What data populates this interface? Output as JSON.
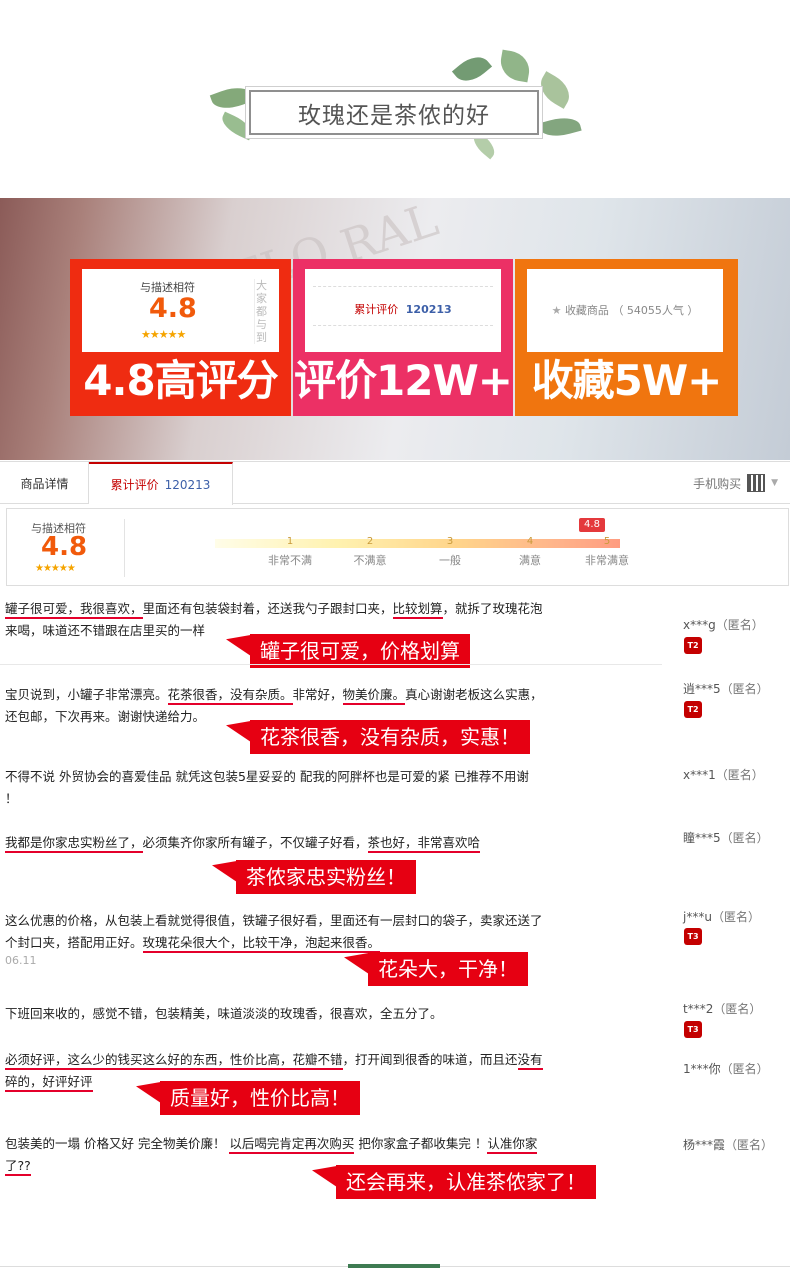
{
  "banner": {
    "title": "玫瑰还是茶侬的好"
  },
  "cards": [
    {
      "label": "与描述相符",
      "score": "4.8",
      "stars": "★★★★★",
      "side_text": "大家都与到",
      "big": "4.8高评分"
    },
    {
      "label": "累计评价",
      "count": "120213",
      "big": "评价12W+"
    },
    {
      "label": "收藏商品",
      "popularity": "（ 54055人气 ）",
      "big": "收藏5W+"
    }
  ],
  "tabs": {
    "details": "商品详情",
    "reviews": "累计评价",
    "reviews_count": "120213",
    "mobile": "手机购买"
  },
  "rating": {
    "label": "与描述相符",
    "score": "4.8",
    "stars": "★★★★★",
    "flag": "4.8",
    "ticks": [
      "1",
      "2",
      "3",
      "4",
      "5"
    ],
    "tick_labels": [
      "非常不满",
      "不满意",
      "一般",
      "满意",
      "非常满意"
    ]
  },
  "reviews": [
    {
      "text_parts": [
        "罐子很可爱，我很喜欢，",
        "里面还有包装袋封着，还送我勺子跟封口夹，",
        "比较划算",
        "，就拆了玫瑰花泡来喝，味道还不错跟在店里买的一样"
      ],
      "callout": "罐子很可爱，价格划算",
      "user": "x***g",
      "anon": "（匿名）",
      "level": "T2"
    },
    {
      "text_parts": [
        "宝贝说到，小罐子非常漂亮。",
        "花茶很香，没有杂质。",
        "非常好，",
        "物美价廉。",
        "真心谢谢老板这么实惠，还包邮，下次再来。谢谢快递给力。"
      ],
      "callout": "花茶很香，没有杂质，实惠！",
      "user": "逍***5",
      "anon": "（匿名）",
      "level": "T2"
    },
    {
      "text_parts": [
        "不得不说 外贸协会的喜爱佳品 就凭这包装5星妥妥的 配我的阿胖杯也是可爱的紧 已推荐不用谢 ！"
      ],
      "callout": "",
      "user": "x***1",
      "anon": "（匿名）",
      "level": ""
    },
    {
      "text_parts": [
        "我都是你家忠实粉丝了，",
        "必须集齐你家所有罐子，不仅罐子好看，",
        "茶也好，非常喜欢哈"
      ],
      "callout": "茶侬家忠实粉丝！",
      "user": "瞳***5",
      "anon": "（匿名）",
      "level": ""
    },
    {
      "text_parts": [
        "这么优惠的价格，从包装上看就觉得很值，铁罐子很好看，里面还有一层封口的袋子，卖家还送了个封口夹，搭配用正好。",
        "玫瑰花朵很大个，比较干净，泡起来很香。"
      ],
      "callout": "花朵大，干净！",
      "user": "j***u",
      "anon": "（匿名）",
      "level": "T3",
      "date": "06.11"
    },
    {
      "text_parts": [
        "下班回来收的，感觉不错，包装精美，味道淡淡的玫瑰香，很喜欢，全五分了。"
      ],
      "callout": "",
      "user": "t***2",
      "anon": "（匿名）",
      "level": "T3"
    },
    {
      "text_parts": [
        "必须好评，这么少的钱买这么好的东西，性价比高，花瓣不错",
        "，打开闻到很香的味道，而且还",
        "没有碎的，好评好评"
      ],
      "callout": "质量好，性价比高！",
      "user": "1***你",
      "anon": "（匿名）",
      "level": ""
    },
    {
      "text_parts": [
        "包装美的一塌 价格又好 完全物美价廉！ ",
        "以后喝完肯定再次购买",
        " 把你家盒子都收集完 ！",
        "认准你家了??"
      ],
      "callout": "还会再来，认准茶侬家了！",
      "user": "杨***霞",
      "anon": "（匿名）",
      "level": ""
    }
  ],
  "colors": {
    "red": "#ef2c11",
    "pink": "#ec3065",
    "orange": "#f0750f",
    "callout": "#e60012",
    "score": "#f15a0b"
  },
  "icons": {
    "star": "star-icon",
    "qr": "qr-code-icon",
    "dropdown": "chevron-down-icon"
  }
}
